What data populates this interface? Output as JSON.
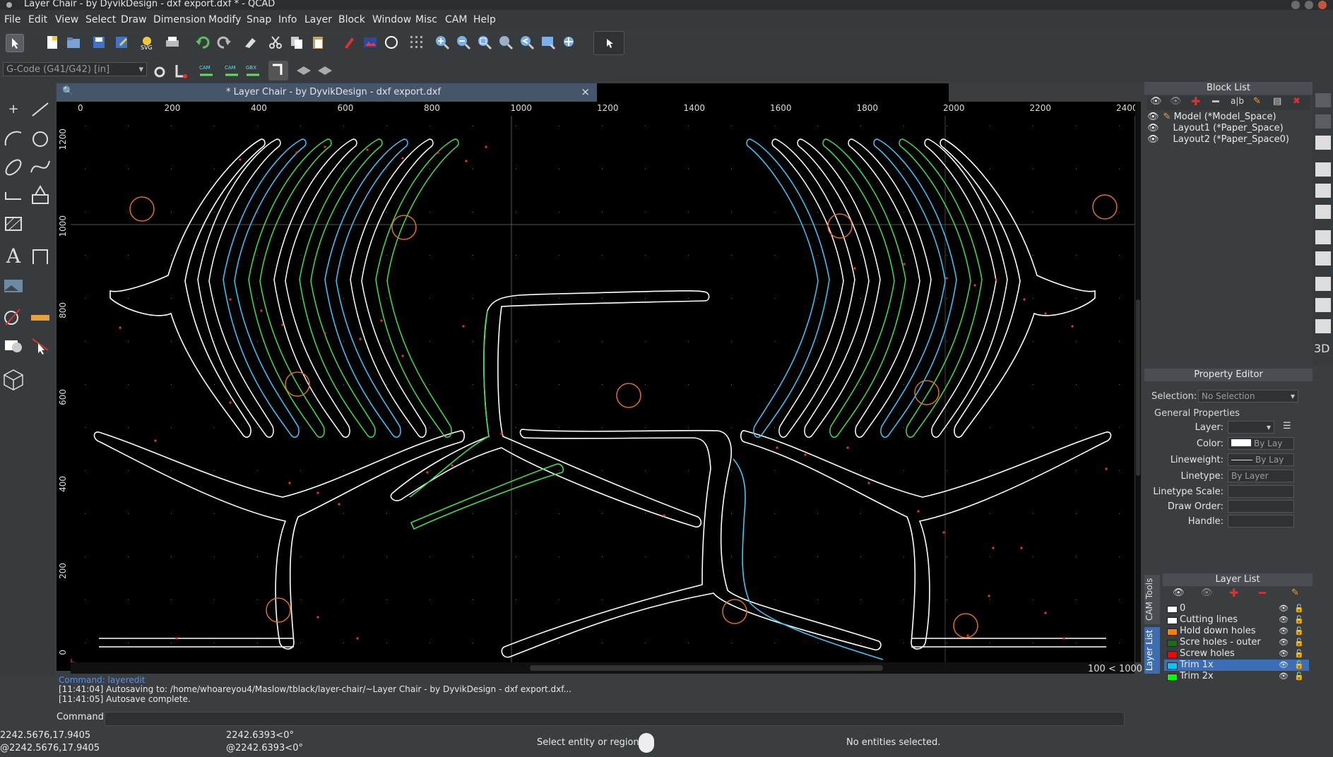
{
  "window": {
    "title": "Layer Chair - by DyvikDesign - dxf export.dxf * - QCAD"
  },
  "menu": [
    "File",
    "Edit",
    "View",
    "Select",
    "Draw",
    "Dimension",
    "Modify",
    "Snap",
    "Info",
    "Layer",
    "Block",
    "Window",
    "Misc",
    "CAM",
    "Help"
  ],
  "toolbar": {
    "icons": [
      "pointer-icon",
      "new-file-icon",
      "open-file-icon",
      "save-icon",
      "save-as-icon",
      "svg-export-icon",
      "print-icon",
      "undo-icon",
      "redo-icon",
      "eraser-icon",
      "cut-icon",
      "copy-icon",
      "paste-icon",
      "pen-icon",
      "image-icon",
      "circle-icon",
      "grid-icon",
      "zoom-in-icon",
      "zoom-out-icon",
      "zoom-auto-icon",
      "zoom-window-icon",
      "zoom-previous-icon",
      "zoom-selection-icon",
      "pan-icon"
    ],
    "gcode_select": "G-Code (G41/G42) [in]"
  },
  "document": {
    "tab_title": "* Layer Chair - by DyvikDesign - dxf export.dxf",
    "close": "×",
    "ruler_x": [
      "0",
      "200",
      "400",
      "600",
      "800",
      "1000",
      "1200",
      "1400",
      "1600",
      "1800",
      "2000",
      "2200",
      "2400"
    ],
    "ruler_y": [
      "1200",
      "1000",
      "800",
      "600",
      "400",
      "200",
      "0"
    ],
    "scale_label": "100 < 1000"
  },
  "console": {
    "lines": [
      "Command: layeredit",
      "[11:41:04] Autosaving to: /home/whoareyou4/Maslow/tblack/layer-chair/~Layer Chair - by DyvikDesign - dxf export.dxf...",
      "[11:41:05] Autosave complete."
    ],
    "command_label": "Command:"
  },
  "status": {
    "abs_coord": "2242.5676,17.9405",
    "rel_coord": "@2242.5676,17.9405",
    "polar": "2242.6393<0°",
    "rel_polar": "@2242.6393<0°",
    "prompt": "Select entity or region",
    "selection": "No entities selected."
  },
  "block_list": {
    "title": "Block List",
    "items": [
      "Model (*Model_Space)",
      "Layout1 (*Paper_Space)",
      "Layout2 (*Paper_Space0)"
    ]
  },
  "property_editor": {
    "title": "Property Editor",
    "selection_label": "Selection:",
    "selection_value": "No Selection",
    "section": "General Properties",
    "fields": [
      {
        "label": "Layer:",
        "value": ""
      },
      {
        "label": "Color:",
        "value": "By Lay"
      },
      {
        "label": "Lineweight:",
        "value": "By Lay"
      },
      {
        "label": "Linetype:",
        "value": "By Layer"
      },
      {
        "label": "Linetype Scale:",
        "value": ""
      },
      {
        "label": "Draw Order:",
        "value": ""
      },
      {
        "label": "Handle:",
        "value": ""
      }
    ]
  },
  "layer_list": {
    "title": "Layer List",
    "side_tabs": [
      "CAM Tools",
      "Layer List"
    ],
    "layers": [
      {
        "name": "0",
        "color": "#ffffff"
      },
      {
        "name": "Cutting lines",
        "color": "#ffffff"
      },
      {
        "name": "Hold down holes",
        "color": "#ff7f00"
      },
      {
        "name": "Scre holes - outer",
        "color": "#1a6b1a"
      },
      {
        "name": "Screw holes",
        "color": "#ff0000"
      },
      {
        "name": "Trim 1x",
        "color": "#00c8ff"
      },
      {
        "name": "Trim 2x",
        "color": "#00ff00"
      }
    ],
    "selected_index": 5
  },
  "right_tools_label": "3D",
  "colors": {
    "accent": "#3d6eb4",
    "hold_down": "#e07020",
    "trim1": "#3cc8ff",
    "trim2": "#3ce04a",
    "screw": "#ff2a2a"
  }
}
